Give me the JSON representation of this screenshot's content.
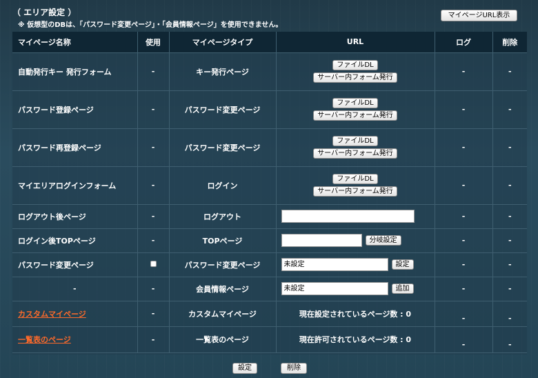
{
  "header": {
    "title": "（ エリア設定 ）",
    "note": "※ 仮想型のDBは、「パスワード変更ページ」・「会員情報ページ」を使用できません。",
    "mypage_url_button": "マイページURL表示"
  },
  "table": {
    "headers": {
      "name": "マイページ名称",
      "use": "使用",
      "type": "マイページタイプ",
      "url": "URL",
      "log": "ログ",
      "delete": "削除"
    },
    "rows": [
      {
        "name": "自動発行キー 発行フォーム",
        "use": "-",
        "type": "キー発行ページ",
        "btn1": "ファイルDL",
        "btn2": "サーバー内フォーム発行",
        "log": "-",
        "delete": "-"
      },
      {
        "name": "パスワード登録ページ",
        "use": "-",
        "type": "パスワード変更ページ",
        "btn1": "ファイルDL",
        "btn2": "サーバー内フォーム発行",
        "log": "-",
        "delete": "-"
      },
      {
        "name": "パスワード再登録ページ",
        "use": "-",
        "type": "パスワード変更ページ",
        "btn1": "ファイルDL",
        "btn2": "サーバー内フォーム発行",
        "log": "-",
        "delete": "-"
      },
      {
        "name": "マイエリアログインフォーム",
        "use": "-",
        "type": "ログイン",
        "btn1": "ファイルDL",
        "btn2": "サーバー内フォーム発行",
        "log": "-",
        "delete": "-"
      },
      {
        "name": "ログアウト後ページ",
        "use": "-",
        "type": "ログアウト",
        "url_value": "",
        "log": "-",
        "delete": "-"
      },
      {
        "name": "ログイン後TOPページ",
        "use": "-",
        "type": "TOPページ",
        "url_value": "",
        "url_btn": "分岐設定",
        "log": "-",
        "delete": "-"
      },
      {
        "name": "パスワード変更ページ",
        "use_checked": false,
        "type": "パスワード変更ページ",
        "url_value": "未設定",
        "url_btn": "設定",
        "log": "-",
        "delete": "-"
      },
      {
        "name": "-",
        "use": "-",
        "type": "会員情報ページ",
        "url_value": "未設定",
        "url_btn": "追加",
        "log": "-",
        "delete": "-"
      },
      {
        "name": "カスタムマイページ",
        "use": "-",
        "type": "カスタムマイページ",
        "count_text": "現在設定されているページ数 : 0",
        "log": "-",
        "delete": "-"
      },
      {
        "name": "一覧表のページ",
        "use": "-",
        "type": "一覧表のページ",
        "count_text": "現在許可されているページ数 : 0",
        "log": "-",
        "delete": "-"
      }
    ]
  },
  "footer": {
    "save": "設定",
    "delete": "削除"
  },
  "colors": {
    "link": "#ff6a2a",
    "header_bg": "#0f2634"
  }
}
